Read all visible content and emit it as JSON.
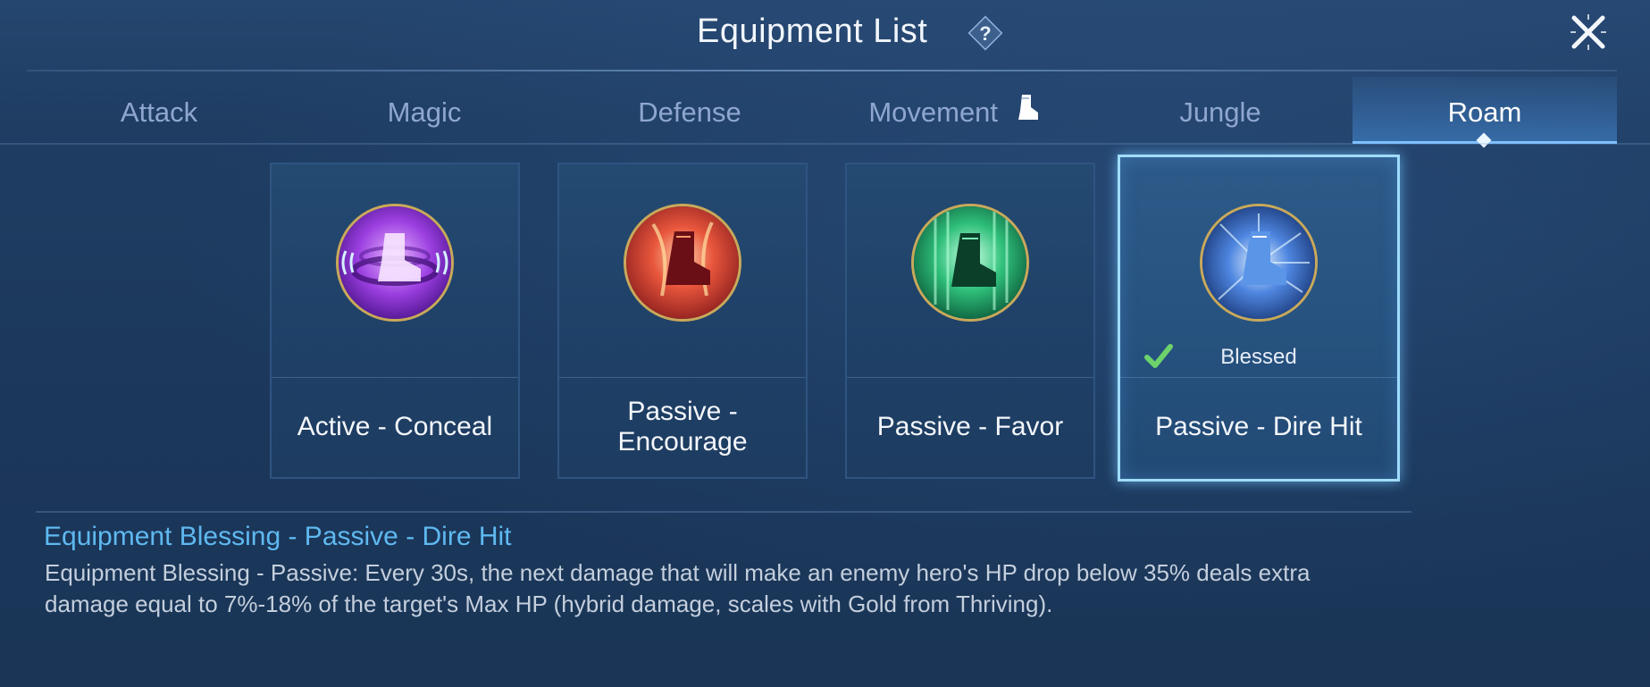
{
  "window": {
    "title": "Equipment List"
  },
  "tabs": [
    {
      "label": "Attack",
      "active": false
    },
    {
      "label": "Magic",
      "active": false
    },
    {
      "label": "Defense",
      "active": false
    },
    {
      "label": "Movement",
      "active": false,
      "icon": "boot-icon"
    },
    {
      "label": "Jungle",
      "active": false
    },
    {
      "label": "Roam",
      "active": true
    }
  ],
  "cards": [
    {
      "label": "Active - Conceal",
      "icon": "purple-boot-icon",
      "selected": false
    },
    {
      "label": "Passive - Encourage",
      "icon": "red-boot-icon",
      "selected": false
    },
    {
      "label": "Passive - Favor",
      "icon": "green-boot-icon",
      "selected": false
    },
    {
      "label": "Passive - Dire Hit",
      "icon": "blue-boot-icon",
      "selected": true,
      "badge": "Blessed"
    }
  ],
  "description": {
    "title": "Equipment Blessing - Passive - Dire Hit",
    "body": "Equipment Blessing -  Passive: Every 30s, the next damage that will make an enemy hero's HP drop below 35% deals extra damage equal to 7%-18% of the target's Max HP (hybrid damage, scales with Gold from Thriving)."
  },
  "colors": {
    "accent": "#5fb9f0",
    "selected_border": "#9fdcff",
    "check": "#6dd26b",
    "icon_ring": "#c9a95a"
  }
}
